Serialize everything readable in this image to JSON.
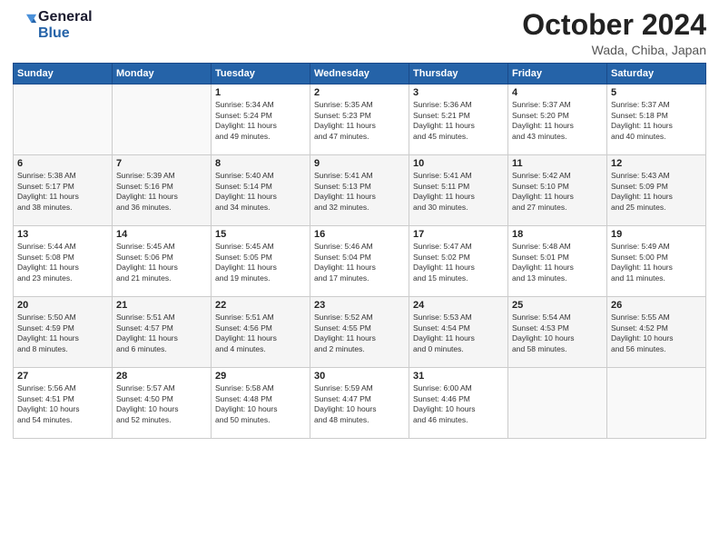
{
  "header": {
    "logo_line1": "General",
    "logo_line2": "Blue",
    "month": "October 2024",
    "location": "Wada, Chiba, Japan"
  },
  "weekdays": [
    "Sunday",
    "Monday",
    "Tuesday",
    "Wednesday",
    "Thursday",
    "Friday",
    "Saturday"
  ],
  "weeks": [
    [
      {
        "day": "",
        "info": ""
      },
      {
        "day": "",
        "info": ""
      },
      {
        "day": "1",
        "info": "Sunrise: 5:34 AM\nSunset: 5:24 PM\nDaylight: 11 hours\nand 49 minutes."
      },
      {
        "day": "2",
        "info": "Sunrise: 5:35 AM\nSunset: 5:23 PM\nDaylight: 11 hours\nand 47 minutes."
      },
      {
        "day": "3",
        "info": "Sunrise: 5:36 AM\nSunset: 5:21 PM\nDaylight: 11 hours\nand 45 minutes."
      },
      {
        "day": "4",
        "info": "Sunrise: 5:37 AM\nSunset: 5:20 PM\nDaylight: 11 hours\nand 43 minutes."
      },
      {
        "day": "5",
        "info": "Sunrise: 5:37 AM\nSunset: 5:18 PM\nDaylight: 11 hours\nand 40 minutes."
      }
    ],
    [
      {
        "day": "6",
        "info": "Sunrise: 5:38 AM\nSunset: 5:17 PM\nDaylight: 11 hours\nand 38 minutes."
      },
      {
        "day": "7",
        "info": "Sunrise: 5:39 AM\nSunset: 5:16 PM\nDaylight: 11 hours\nand 36 minutes."
      },
      {
        "day": "8",
        "info": "Sunrise: 5:40 AM\nSunset: 5:14 PM\nDaylight: 11 hours\nand 34 minutes."
      },
      {
        "day": "9",
        "info": "Sunrise: 5:41 AM\nSunset: 5:13 PM\nDaylight: 11 hours\nand 32 minutes."
      },
      {
        "day": "10",
        "info": "Sunrise: 5:41 AM\nSunset: 5:11 PM\nDaylight: 11 hours\nand 30 minutes."
      },
      {
        "day": "11",
        "info": "Sunrise: 5:42 AM\nSunset: 5:10 PM\nDaylight: 11 hours\nand 27 minutes."
      },
      {
        "day": "12",
        "info": "Sunrise: 5:43 AM\nSunset: 5:09 PM\nDaylight: 11 hours\nand 25 minutes."
      }
    ],
    [
      {
        "day": "13",
        "info": "Sunrise: 5:44 AM\nSunset: 5:08 PM\nDaylight: 11 hours\nand 23 minutes."
      },
      {
        "day": "14",
        "info": "Sunrise: 5:45 AM\nSunset: 5:06 PM\nDaylight: 11 hours\nand 21 minutes."
      },
      {
        "day": "15",
        "info": "Sunrise: 5:45 AM\nSunset: 5:05 PM\nDaylight: 11 hours\nand 19 minutes."
      },
      {
        "day": "16",
        "info": "Sunrise: 5:46 AM\nSunset: 5:04 PM\nDaylight: 11 hours\nand 17 minutes."
      },
      {
        "day": "17",
        "info": "Sunrise: 5:47 AM\nSunset: 5:02 PM\nDaylight: 11 hours\nand 15 minutes."
      },
      {
        "day": "18",
        "info": "Sunrise: 5:48 AM\nSunset: 5:01 PM\nDaylight: 11 hours\nand 13 minutes."
      },
      {
        "day": "19",
        "info": "Sunrise: 5:49 AM\nSunset: 5:00 PM\nDaylight: 11 hours\nand 11 minutes."
      }
    ],
    [
      {
        "day": "20",
        "info": "Sunrise: 5:50 AM\nSunset: 4:59 PM\nDaylight: 11 hours\nand 8 minutes."
      },
      {
        "day": "21",
        "info": "Sunrise: 5:51 AM\nSunset: 4:57 PM\nDaylight: 11 hours\nand 6 minutes."
      },
      {
        "day": "22",
        "info": "Sunrise: 5:51 AM\nSunset: 4:56 PM\nDaylight: 11 hours\nand 4 minutes."
      },
      {
        "day": "23",
        "info": "Sunrise: 5:52 AM\nSunset: 4:55 PM\nDaylight: 11 hours\nand 2 minutes."
      },
      {
        "day": "24",
        "info": "Sunrise: 5:53 AM\nSunset: 4:54 PM\nDaylight: 11 hours\nand 0 minutes."
      },
      {
        "day": "25",
        "info": "Sunrise: 5:54 AM\nSunset: 4:53 PM\nDaylight: 10 hours\nand 58 minutes."
      },
      {
        "day": "26",
        "info": "Sunrise: 5:55 AM\nSunset: 4:52 PM\nDaylight: 10 hours\nand 56 minutes."
      }
    ],
    [
      {
        "day": "27",
        "info": "Sunrise: 5:56 AM\nSunset: 4:51 PM\nDaylight: 10 hours\nand 54 minutes."
      },
      {
        "day": "28",
        "info": "Sunrise: 5:57 AM\nSunset: 4:50 PM\nDaylight: 10 hours\nand 52 minutes."
      },
      {
        "day": "29",
        "info": "Sunrise: 5:58 AM\nSunset: 4:48 PM\nDaylight: 10 hours\nand 50 minutes."
      },
      {
        "day": "30",
        "info": "Sunrise: 5:59 AM\nSunset: 4:47 PM\nDaylight: 10 hours\nand 48 minutes."
      },
      {
        "day": "31",
        "info": "Sunrise: 6:00 AM\nSunset: 4:46 PM\nDaylight: 10 hours\nand 46 minutes."
      },
      {
        "day": "",
        "info": ""
      },
      {
        "day": "",
        "info": ""
      }
    ]
  ]
}
